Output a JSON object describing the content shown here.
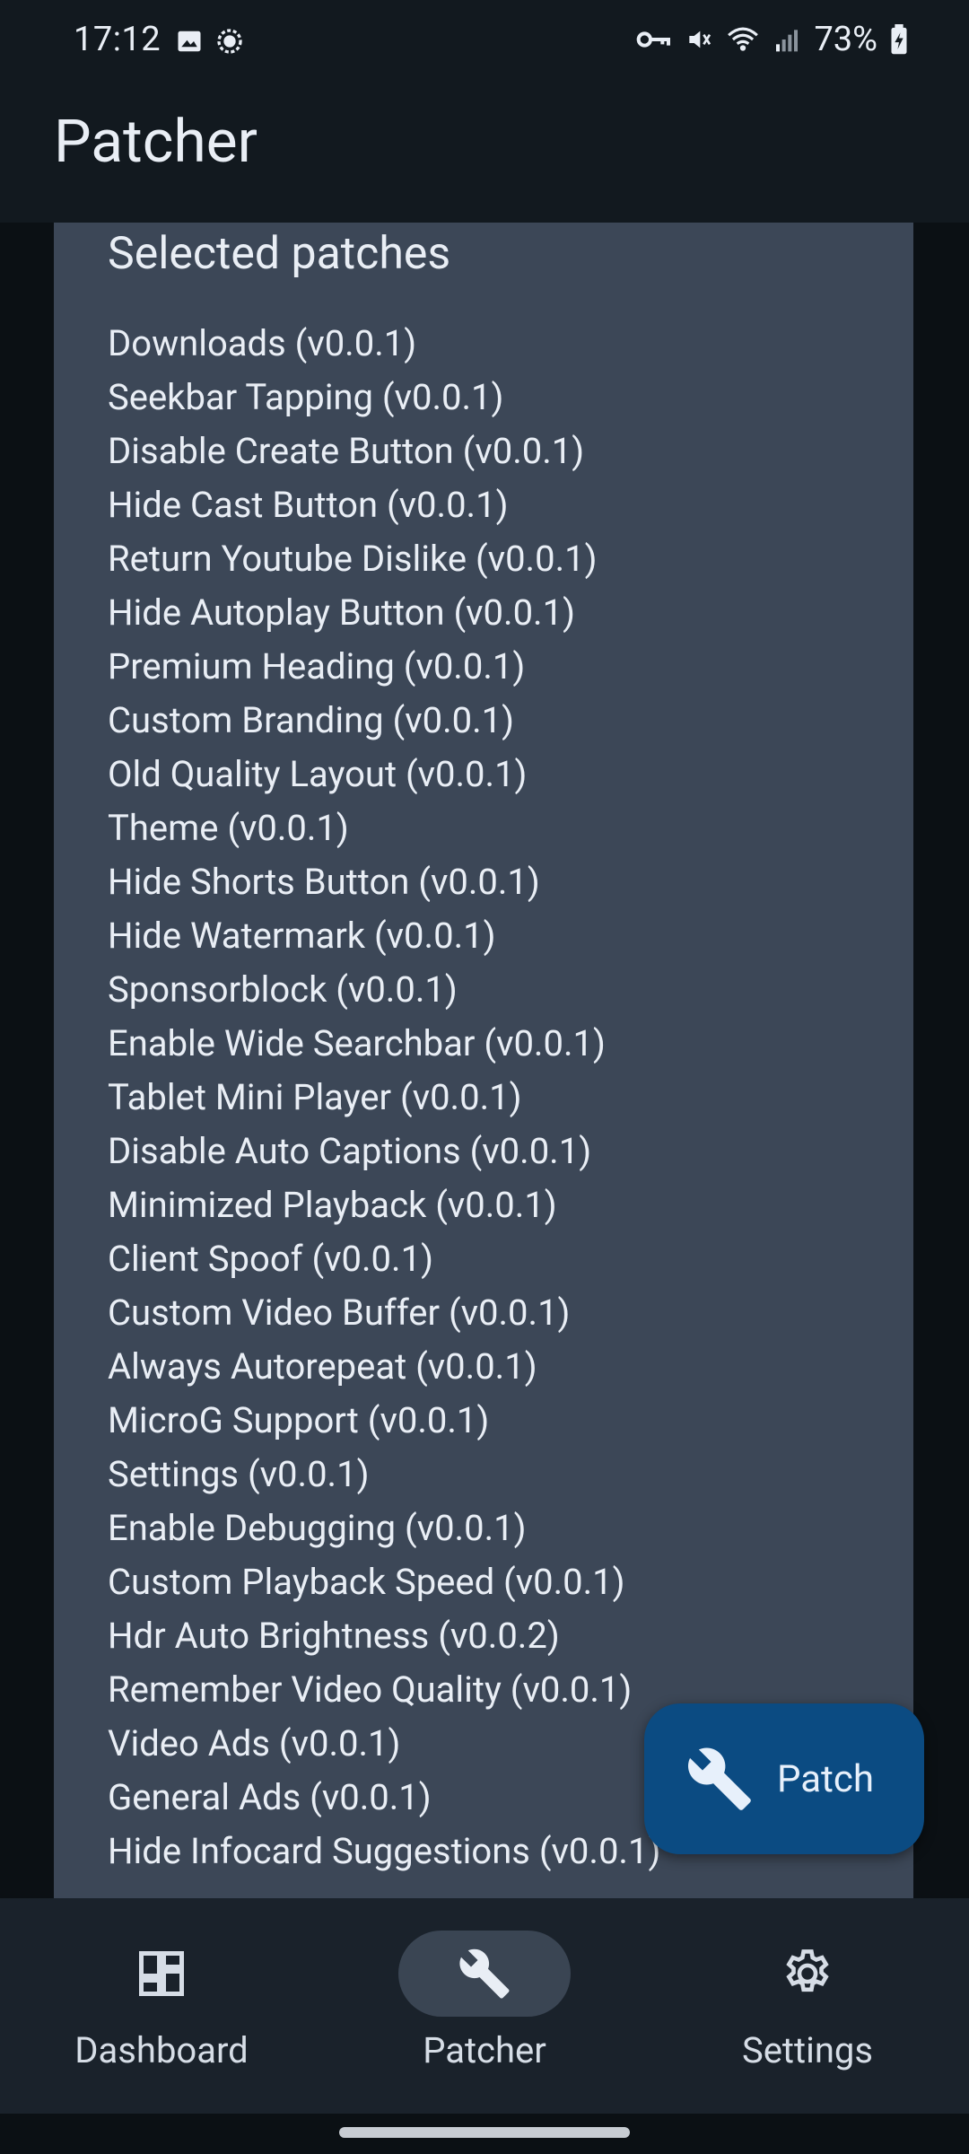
{
  "status_bar": {
    "time": "17:12",
    "battery": "73%",
    "icons": [
      "image-icon",
      "sync-icon",
      "vpn-key-icon",
      "mute-icon",
      "wifi-icon",
      "signal-icon",
      "battery-icon"
    ]
  },
  "app": {
    "title": "Patcher"
  },
  "card": {
    "title": "Selected patches",
    "patches": [
      "Downloads (v0.0.1)",
      "Seekbar Tapping (v0.0.1)",
      "Disable Create Button (v0.0.1)",
      "Hide Cast Button (v0.0.1)",
      "Return Youtube Dislike (v0.0.1)",
      "Hide Autoplay Button (v0.0.1)",
      "Premium Heading (v0.0.1)",
      "Custom Branding (v0.0.1)",
      "Old Quality Layout (v0.0.1)",
      "Theme (v0.0.1)",
      "Hide Shorts Button (v0.0.1)",
      "Hide Watermark (v0.0.1)",
      "Sponsorblock (v0.0.1)",
      "Enable Wide Searchbar (v0.0.1)",
      "Tablet Mini Player (v0.0.1)",
      "Disable Auto Captions (v0.0.1)",
      "Minimized Playback (v0.0.1)",
      "Client Spoof (v0.0.1)",
      "Custom Video Buffer (v0.0.1)",
      "Always Autorepeat (v0.0.1)",
      "MicroG Support (v0.0.1)",
      "Settings (v0.0.1)",
      "Enable Debugging (v0.0.1)",
      "Custom Playback Speed (v0.0.1)",
      "Hdr Auto Brightness (v0.0.2)",
      "Remember Video Quality (v0.0.1)",
      "Video Ads (v0.0.1)",
      "General Ads (v0.0.1)",
      "Hide Infocard Suggestions (v0.0.1)"
    ]
  },
  "fab": {
    "label": "Patch",
    "icon": "wrench-icon"
  },
  "nav": {
    "items": [
      {
        "label": "Dashboard",
        "icon": "dashboard-icon",
        "active": false
      },
      {
        "label": "Patcher",
        "icon": "wrench-icon",
        "active": true
      },
      {
        "label": "Settings",
        "icon": "gear-icon",
        "active": false
      }
    ]
  },
  "colors": {
    "background": "#0b1014",
    "appbar": "#12191f",
    "card": "#3c4757",
    "fab": "#0b4b82",
    "navbar": "#1a222b",
    "nav_active_pill": "#3a4553"
  }
}
